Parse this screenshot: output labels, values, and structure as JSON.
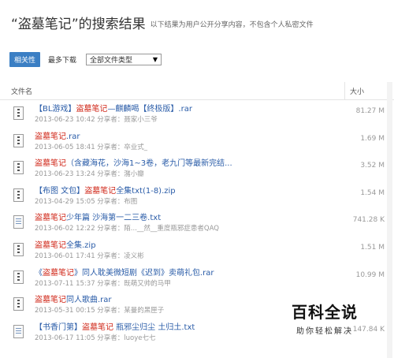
{
  "header": {
    "title_prefix": "“",
    "title_keyword": "盗墓笔记",
    "title_suffix": "”的搜索结果",
    "note": "以下结果为用户公开分享内容，不包含个人私密文件"
  },
  "toolbar": {
    "sort_relevance": "相关性",
    "sort_downloads": "最多下载",
    "file_type_select": "全部文件类型"
  },
  "table": {
    "col_name": "文件名",
    "col_size": "大小"
  },
  "files": [
    {
      "pre": "【BL游戏】",
      "hl": "盗墓笔记",
      "post": "—麒麟喝【终极版】.rar",
      "meta": "2013-06-23 10:42  分享者：聂家小三爷",
      "size": "81.27 M",
      "icon": "zip"
    },
    {
      "pre": "",
      "hl": "盗墓笔记",
      "post": ".rar",
      "meta": "2013-06-05 18:41  分享者：卒业式_",
      "size": "1.69 M",
      "icon": "zip"
    },
    {
      "pre": "",
      "hl": "盗墓笔记",
      "post": "（含藏海花，沙海1~3卷，老九门等最新完结...",
      "meta": "2013-06-23 13:24  分享者：潴小瓣",
      "size": "3.52 M",
      "icon": "zip"
    },
    {
      "pre": "【布图 文包】",
      "hl": "盗墓笔记",
      "post": "全集txt(1-8).zip",
      "meta": "2013-04-29 15:05  分享者：布图",
      "size": "1.54 M",
      "icon": "zip"
    },
    {
      "pre": "",
      "hl": "盗墓笔记",
      "post": "少年篇 沙海第一二三卷.txt",
      "meta": "2013-06-02 12:22  分享者：陌...__然__重度瓶邪症患者QAQ",
      "size": "741.28 K",
      "icon": "txt"
    },
    {
      "pre": "",
      "hl": "盗墓笔记",
      "post": "全集.zip",
      "meta": "2013-06-01 17:41  分享者：凌义彬",
      "size": "1.51 M",
      "icon": "zip"
    },
    {
      "pre": "《",
      "hl": "盗墓笔记",
      "post": "》同人耽美微短剧《迟到》卖萌礼包.rar",
      "meta": "2013-07-11 15:37  分享者：既萌又帅的马甲",
      "size": "10.99 M",
      "icon": "zip"
    },
    {
      "pre": "",
      "hl": "盗墓笔记",
      "post": "同人歌曲.rar",
      "meta": "2013-05-31 00:15  分享者：某曼的黑匣子",
      "size": "",
      "icon": "zip"
    },
    {
      "pre": "【书香门第】",
      "hl": "盗墓笔记",
      "post": " 瓶邪尘归尘 土归土.txt",
      "meta": "2013-06-17 11:05  分享者：luoye七七",
      "size": "147.84 K",
      "icon": "txt"
    }
  ],
  "watermark": {
    "big": "百科全说",
    "small": "助你轻松解决"
  }
}
